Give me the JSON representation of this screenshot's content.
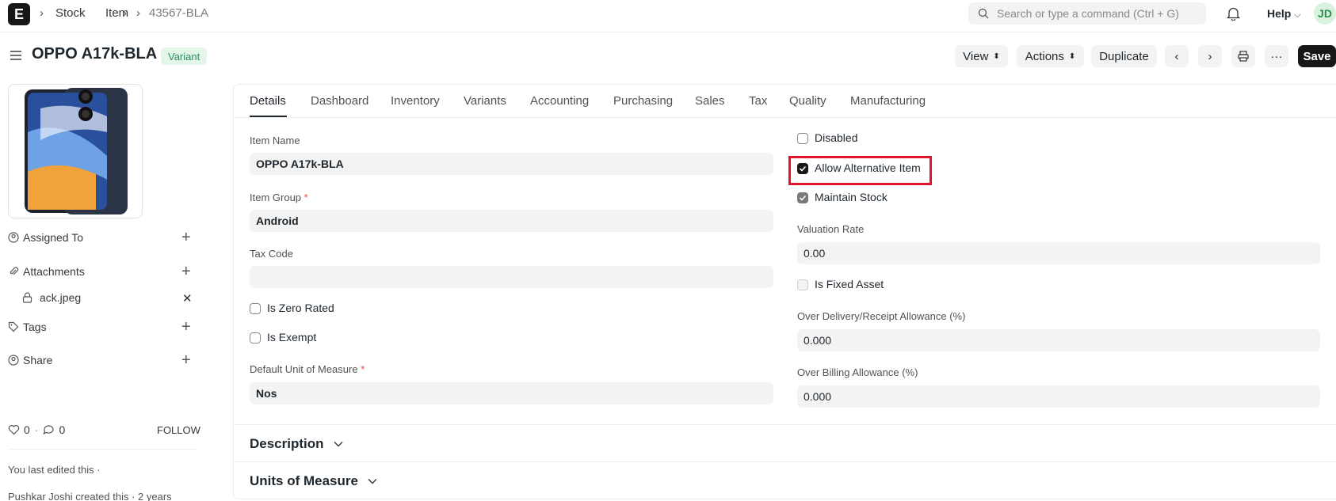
{
  "topbar": {
    "logo": "E",
    "breadcrumbs": [
      "Stock",
      "Item",
      "43567-BLA"
    ],
    "search_placeholder": "Search or type a command (Ctrl + G)",
    "help_label": "Help",
    "avatar_initials": "JD"
  },
  "header": {
    "title": "OPPO A17k-BLA",
    "badge": "Variant",
    "buttons": {
      "view": "View",
      "actions": "Actions",
      "duplicate": "Duplicate",
      "save": "Save"
    }
  },
  "sidebar": {
    "assigned_to": "Assigned To",
    "attachments": "Attachments",
    "attachment_file": "ack.jpeg",
    "tags": "Tags",
    "share": "Share",
    "likes": "0",
    "comments": "0",
    "follow": "FOLLOW",
    "activity": [
      "You last edited this ·",
      "Pushkar Joshi created this · 2 years"
    ]
  },
  "tabs": [
    "Details",
    "Dashboard",
    "Inventory",
    "Variants",
    "Accounting",
    "Purchasing",
    "Sales",
    "Tax",
    "Quality",
    "Manufacturing"
  ],
  "form_left": {
    "item_name_label": "Item Name",
    "item_name_value": "OPPO A17k-BLA",
    "item_group_label": "Item Group",
    "item_group_value": "Android",
    "tax_code_label": "Tax Code",
    "tax_code_value": "",
    "is_zero_rated": "Is Zero Rated",
    "is_exempt": "Is Exempt",
    "uom_label": "Default Unit of Measure",
    "uom_value": "Nos",
    "required_mark": "*"
  },
  "form_right": {
    "disabled": "Disabled",
    "allow_alternative": "Allow Alternative Item",
    "maintain_stock": "Maintain Stock",
    "valuation_rate_label": "Valuation Rate",
    "valuation_rate_value": "0.00",
    "is_fixed_asset": "Is Fixed Asset",
    "over_delivery_label": "Over Delivery/Receipt Allowance (%)",
    "over_delivery_value": "0.000",
    "over_billing_label": "Over Billing Allowance (%)",
    "over_billing_value": "0.000"
  },
  "checkbox_states": {
    "disabled": false,
    "allow_alternative": true,
    "maintain_stock": true,
    "is_fixed_asset": false,
    "is_zero_rated": false,
    "is_exempt": false
  },
  "sections": {
    "description": "Description",
    "uom": "Units of Measure"
  },
  "colors": {
    "accent": "#171717",
    "badge_bg": "#e4f5e9",
    "badge_fg": "#278f5e",
    "highlight": "#e0152d"
  }
}
